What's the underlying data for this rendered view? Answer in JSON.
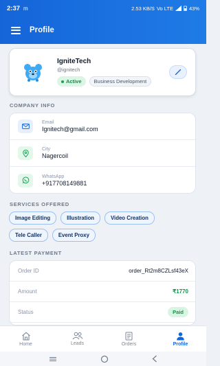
{
  "status_bar": {
    "time": "2:37",
    "carrier_icon": "m",
    "network": "2.53 KB/S",
    "signal": "Vo LTE",
    "battery": "43%"
  },
  "app_bar": {
    "title": "Profile"
  },
  "profile": {
    "name": "IgniteTech",
    "username": "@ignitech",
    "status": "Active",
    "department": "Business Development"
  },
  "company_info": {
    "section_title": "COMPANY INFO",
    "items": [
      {
        "label": "Email",
        "value": "Ignitech@gmail.com",
        "icon": "mail-icon",
        "color": "#1565d8",
        "bg": "#e6f0fd"
      },
      {
        "label": "City",
        "value": "Nagercoil",
        "icon": "location-pin-icon",
        "color": "#1aa352",
        "bg": "#e3f7eb"
      },
      {
        "label": "WhatsApp",
        "value": "+917708149881",
        "icon": "whatsapp-icon",
        "color": "#1aa352",
        "bg": "#e3f7eb"
      }
    ]
  },
  "services": {
    "section_title": "SERVICES OFFERED",
    "items": [
      "Image Editing",
      "Illustration",
      "Video Creation",
      "Tele Caller",
      "Event Proxy"
    ]
  },
  "payment": {
    "section_title": "LATEST PAYMENT",
    "order_id_label": "Order ID",
    "order_id": "order_Rt2m8CZLsf43eX",
    "amount_label": "Amount",
    "amount": "₹1770",
    "status_label": "Status",
    "status": "Paid"
  },
  "bottom_nav": {
    "items": [
      {
        "label": "Home",
        "icon": "home-icon",
        "active": false
      },
      {
        "label": "Leads",
        "icon": "people-icon",
        "active": false
      },
      {
        "label": "Orders",
        "icon": "receipt-icon",
        "active": false
      },
      {
        "label": "Profile",
        "icon": "person-icon",
        "active": true
      }
    ]
  },
  "colors": {
    "brand": "#1565d8",
    "success": "#1aa352",
    "background": "#eef2f7"
  }
}
